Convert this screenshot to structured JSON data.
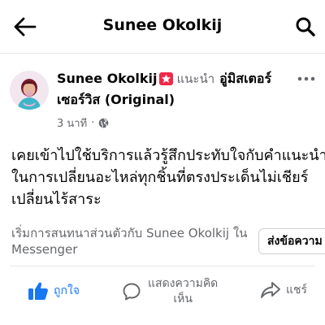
{
  "header": {
    "title": "Sunee Okolkij",
    "back_icon": "arrow-left-icon",
    "search_icon": "search-icon"
  },
  "post": {
    "author": "Sunee Okolkij",
    "badge_icon": "recommend-star-icon",
    "action_text": "แนะนำ",
    "page_name_line1": "อู่มิสเตอร์",
    "page_name_line2": "เซอร์วิส (Original)",
    "time": "3 นาที",
    "separator": "·",
    "privacy_icon": "globe-icon",
    "more_icon": "more-dots-icon",
    "body_lines": [
      "เคยเข้าไปใช้บริการแล้วรู้สึกประทับใจกับคำแนะนำ",
      "ในการเปลี่ยนอะไหล่ทุกชิ้นที่ตรงประเด็นไม่เชียร์",
      "เปลี่ยนไร้สาระ"
    ]
  },
  "messenger": {
    "prompt_lines": [
      "เริ่มการสนทนาส่วนตัวกับ Sunee Okolkij ใน",
      "Messenger"
    ],
    "button_label": "ส่งข้อความ"
  },
  "actions": {
    "like_label": "ถูกใจ",
    "like_icon": "thumbs-up-icon",
    "comment_label_lines": [
      "แสดงความคิด",
      "เห็น"
    ],
    "comment_icon": "comment-bubble-icon",
    "share_label": "แชร์",
    "share_icon": "share-arrow-icon"
  },
  "colors": {
    "accent": "#1877f2",
    "badge": "#f0284a",
    "text_primary": "#050505",
    "text_secondary": "#65676b"
  }
}
